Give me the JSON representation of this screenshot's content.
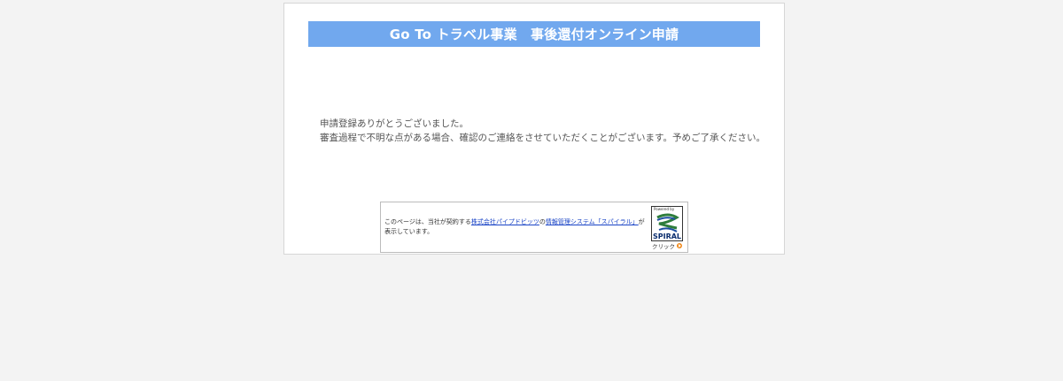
{
  "header": {
    "title": "Go To トラベル事業　事後還付オンライン申請"
  },
  "message": {
    "line1": "申請登録ありがとうございました。",
    "line2": "審査過程で不明な点がある場合、確認のご連絡をさせていただくことがございます。予めご了承ください。"
  },
  "footer_banner": {
    "text_before": "このページは、当社が契約する",
    "company_link": "株式会社パイプドビッツ",
    "text_middle": "の",
    "system_link": "情報管理システム「スパイラル」",
    "text_after": "が表示しています。",
    "logo": {
      "powered_by": "Powered by",
      "brand": "SPIRAL",
      "click_label": "クリック"
    }
  },
  "colors": {
    "page_background": "#f3f3f3",
    "title_bar": "#71a8ee",
    "link": "#1a44c6",
    "click_arrow": "#f08a1c"
  }
}
